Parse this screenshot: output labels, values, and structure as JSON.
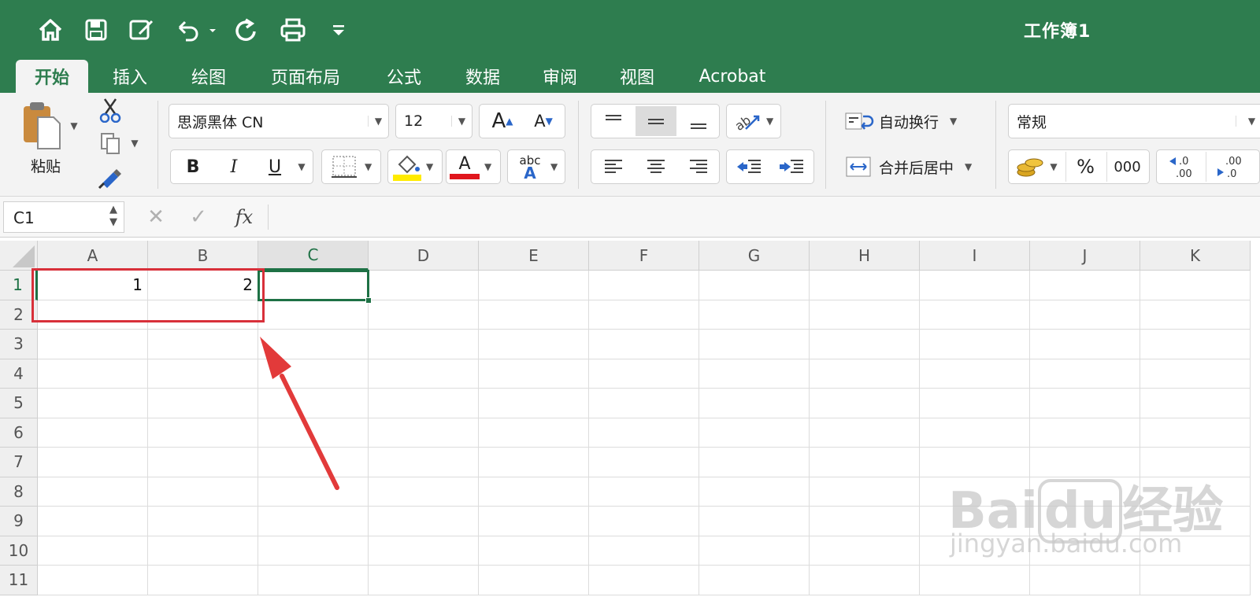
{
  "window": {
    "title": "工作簿1"
  },
  "tabs": [
    "开始",
    "插入",
    "绘图",
    "页面布局",
    "公式",
    "数据",
    "审阅",
    "视图",
    "Acrobat"
  ],
  "ribbon": {
    "paste_label": "粘贴",
    "font_name": "思源黑体 CN",
    "font_size": "12",
    "bold": "B",
    "italic": "I",
    "underline": "U",
    "font_color_letter": "A",
    "grow_font": "A",
    "shrink_font": "A",
    "phonetic_top": "abc",
    "phonetic_bottom": "A",
    "wrap_text": "自动换行",
    "merge_center": "合并后居中",
    "number_format": "常规",
    "percent": "%",
    "thousands": "000",
    "inc_decimal": ".0\n.00",
    "colors": {
      "highlight": "#ffeb00",
      "font_color": "#e0161d",
      "accent": "#1e7145"
    }
  },
  "formula_bar": {
    "cell_ref": "C1",
    "fx": "fx",
    "formula": ""
  },
  "sheet": {
    "columns": [
      "A",
      "B",
      "C",
      "D",
      "E",
      "F",
      "G",
      "H",
      "I",
      "J",
      "K"
    ],
    "rows": [
      "1",
      "2",
      "3",
      "4",
      "5",
      "6",
      "7",
      "8",
      "9",
      "10",
      "11"
    ],
    "active_cell": "C1",
    "cells": {
      "A1": "1",
      "B1": "2"
    }
  },
  "watermark": {
    "line1": "Bai",
    "line1b": "du",
    "line1c": "经验",
    "line2": "jingyan.baidu.com"
  }
}
